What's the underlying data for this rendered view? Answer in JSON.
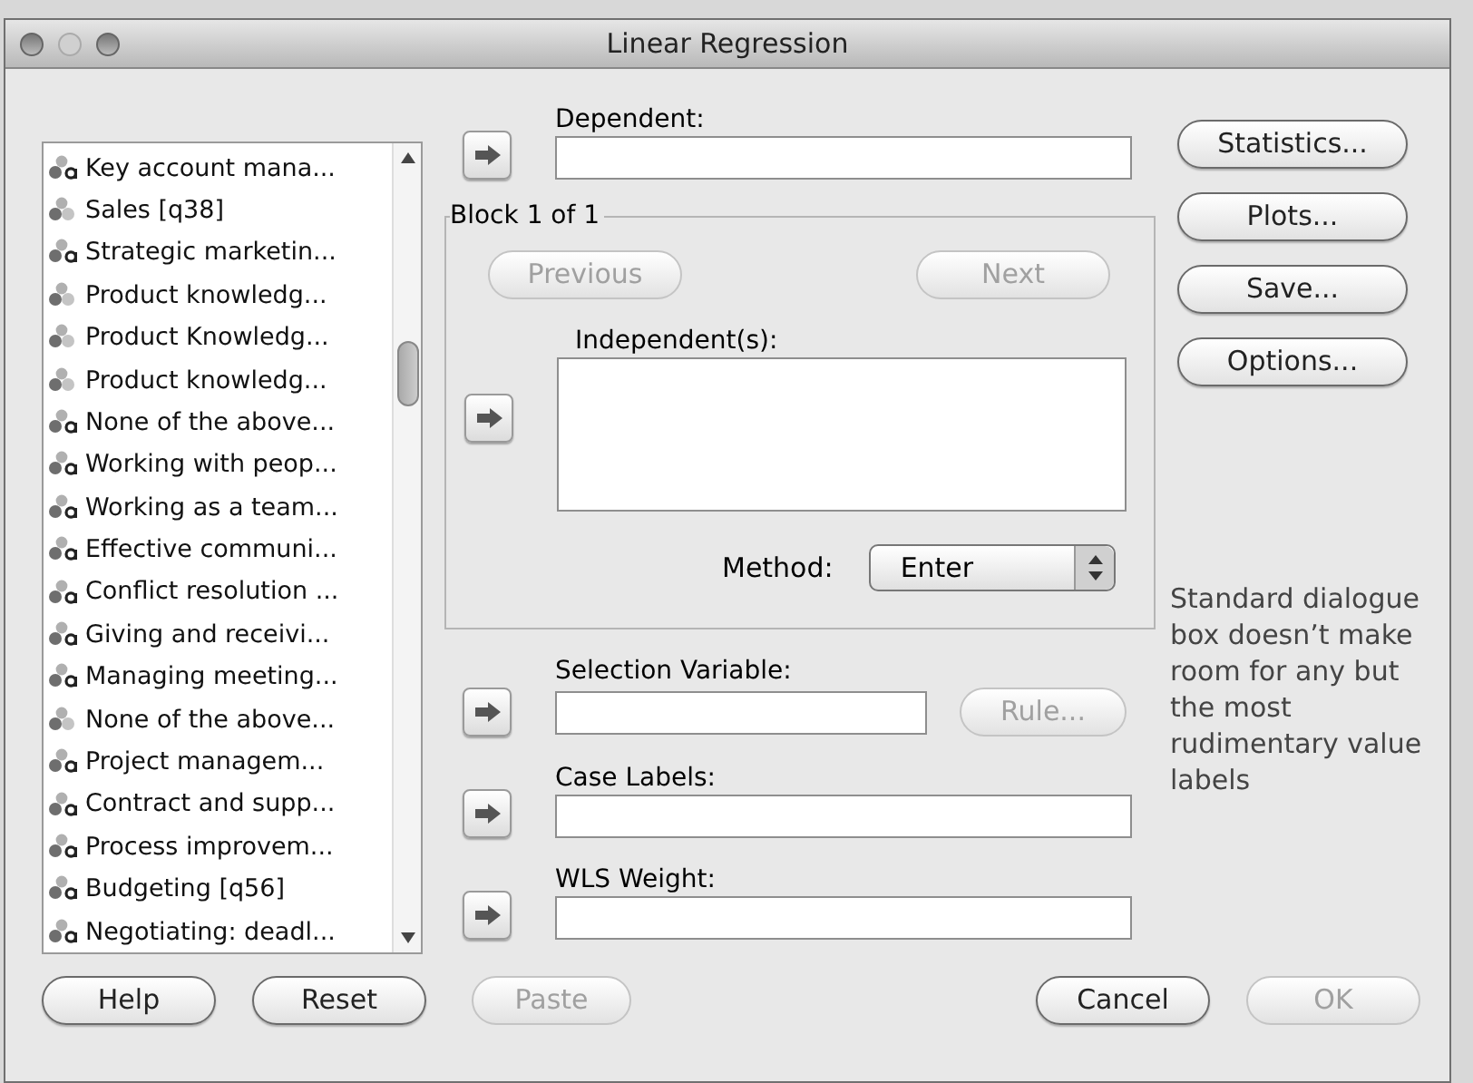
{
  "window": {
    "title": "Linear Regression"
  },
  "variables": [
    {
      "label": "Key account mana...",
      "kind": "string"
    },
    {
      "label": "Sales  [q38]",
      "kind": "nominal"
    },
    {
      "label": "Strategic marketin...",
      "kind": "string"
    },
    {
      "label": "Product knowledg...",
      "kind": "nominal"
    },
    {
      "label": "Product Knowledg...",
      "kind": "nominal"
    },
    {
      "label": "Product knowledg...",
      "kind": "nominal"
    },
    {
      "label": "None of the above...",
      "kind": "string"
    },
    {
      "label": "Working with peop...",
      "kind": "string"
    },
    {
      "label": "Working as a team...",
      "kind": "string"
    },
    {
      "label": "Effective communi...",
      "kind": "string"
    },
    {
      "label": "Conflict resolution ...",
      "kind": "string"
    },
    {
      "label": "Giving and receivi...",
      "kind": "string"
    },
    {
      "label": "Managing meeting...",
      "kind": "string"
    },
    {
      "label": "None of the above...",
      "kind": "nominal"
    },
    {
      "label": "Project managem...",
      "kind": "string"
    },
    {
      "label": "Contract and supp...",
      "kind": "string"
    },
    {
      "label": "Process improvem...",
      "kind": "string"
    },
    {
      "label": "Budgeting [q56]",
      "kind": "string"
    },
    {
      "label": "Negotiating: deadl...",
      "kind": "string"
    }
  ],
  "dependent": {
    "label": "Dependent:"
  },
  "block": {
    "title": "Block 1 of 1",
    "previous": {
      "label": "Previous",
      "disabled": true
    },
    "next": {
      "label": "Next",
      "disabled": true
    },
    "independents_label": "Independent(s):",
    "method": {
      "label": "Method:",
      "value": "Enter"
    }
  },
  "selection_variable": {
    "label": "Selection Variable:"
  },
  "rule": {
    "label": "Rule...",
    "disabled": true
  },
  "case_labels": {
    "label": "Case Labels:"
  },
  "wls_weight": {
    "label": "WLS Weight:"
  },
  "side_buttons": [
    {
      "label": "Statistics...",
      "disabled": false
    },
    {
      "label": "Plots...",
      "disabled": false
    },
    {
      "label": "Save...",
      "disabled": false
    },
    {
      "label": "Options...",
      "disabled": false
    }
  ],
  "note": "Standard dialogue box doesn’t make room for any but the most rudimentary value labels",
  "footer_buttons": [
    {
      "label": "Help",
      "disabled": false
    },
    {
      "label": "Reset",
      "disabled": false
    },
    {
      "label": "Paste",
      "disabled": true
    },
    {
      "label": "Cancel",
      "disabled": false
    },
    {
      "label": "OK",
      "disabled": true
    }
  ]
}
